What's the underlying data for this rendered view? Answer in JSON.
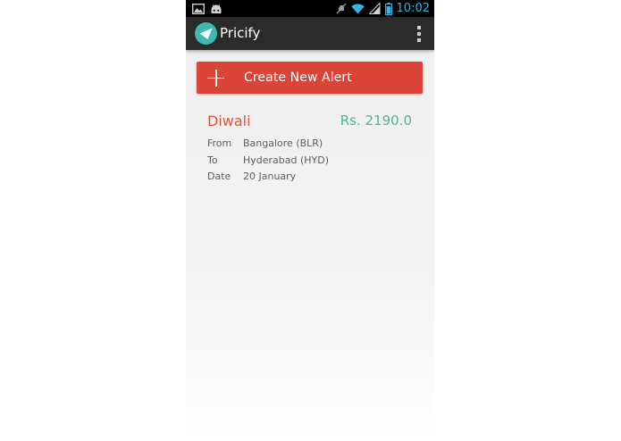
{
  "status_bar": {
    "time": "10:02",
    "icons": [
      "gallery-icon",
      "android-icon",
      "mute-icon",
      "wifi-icon",
      "signal-icon",
      "battery-icon"
    ]
  },
  "action_bar": {
    "title": "Pricify",
    "logo_icon": "paper-plane-icon",
    "overflow_icon": "overflow-menu-icon"
  },
  "create_alert": {
    "label": "Create New Alert",
    "icon": "plus-icon"
  },
  "alerts": [
    {
      "name": "Diwali",
      "price": "Rs. 2190.0",
      "from_label": "From",
      "from_value": "Bangalore (BLR)",
      "to_label": "To",
      "to_value": "Hyderabad (HYD)",
      "date_label": "Date",
      "date_value": "20 January"
    }
  ],
  "colors": {
    "action_bar": "#2b2b2b",
    "accent_red": "#dc4438",
    "alert_name": "#e0533f",
    "price_green": "#49b98a",
    "status_time": "#33b5e5",
    "logo_teal": "#3fb8b3"
  }
}
